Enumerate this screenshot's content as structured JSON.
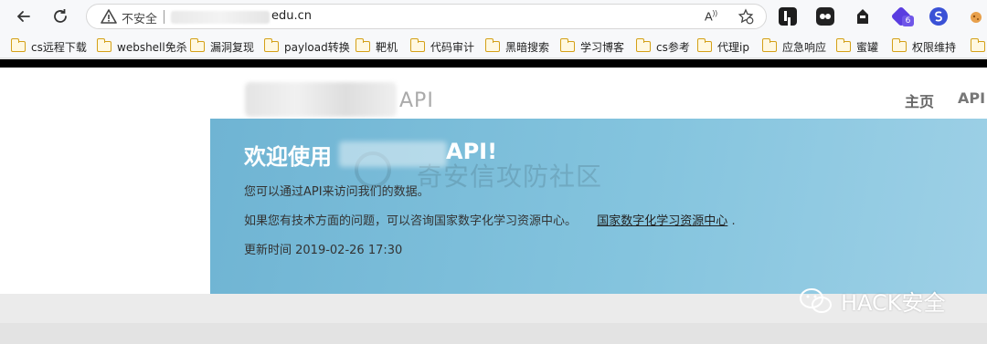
{
  "browser": {
    "security_label": "不安全",
    "url_visible": "edu.cn",
    "read_aloud_label": "A)",
    "extension_badge": "6"
  },
  "bookmarks": [
    {
      "label": "cs远程下载"
    },
    {
      "label": "webshell免杀"
    },
    {
      "label": "漏洞复现"
    },
    {
      "label": "payload转换"
    },
    {
      "label": "靶机"
    },
    {
      "label": "代码审计"
    },
    {
      "label": "黑暗搜索"
    },
    {
      "label": "学习博客"
    },
    {
      "label": "cs参考"
    },
    {
      "label": "代理ip"
    },
    {
      "label": "应急响应"
    },
    {
      "label": "蜜罐"
    },
    {
      "label": "权限维持"
    }
  ],
  "site": {
    "brand_suffix": "API",
    "nav": {
      "home": "主页",
      "api": "API"
    }
  },
  "jumbotron": {
    "title_prefix": "欢迎使用",
    "title_suffix": "API!",
    "line1": "您可以通过API来访问我们的数据。",
    "line2_text": "如果您有技术方面的问题，可以咨询国家数字化学习资源中心。",
    "line2_link": "国家数字化学习资源中心",
    "line2_end": ".",
    "updated": "更新时间 2019-02-26 17:30",
    "watermark": "奇安信攻防社区"
  },
  "overlay": {
    "wechat_label": "HACK安全"
  },
  "colors": {
    "jumbotron": "#84c4de",
    "page_bg": "#ffffff",
    "chrome_bg": "#f7f8fa"
  }
}
